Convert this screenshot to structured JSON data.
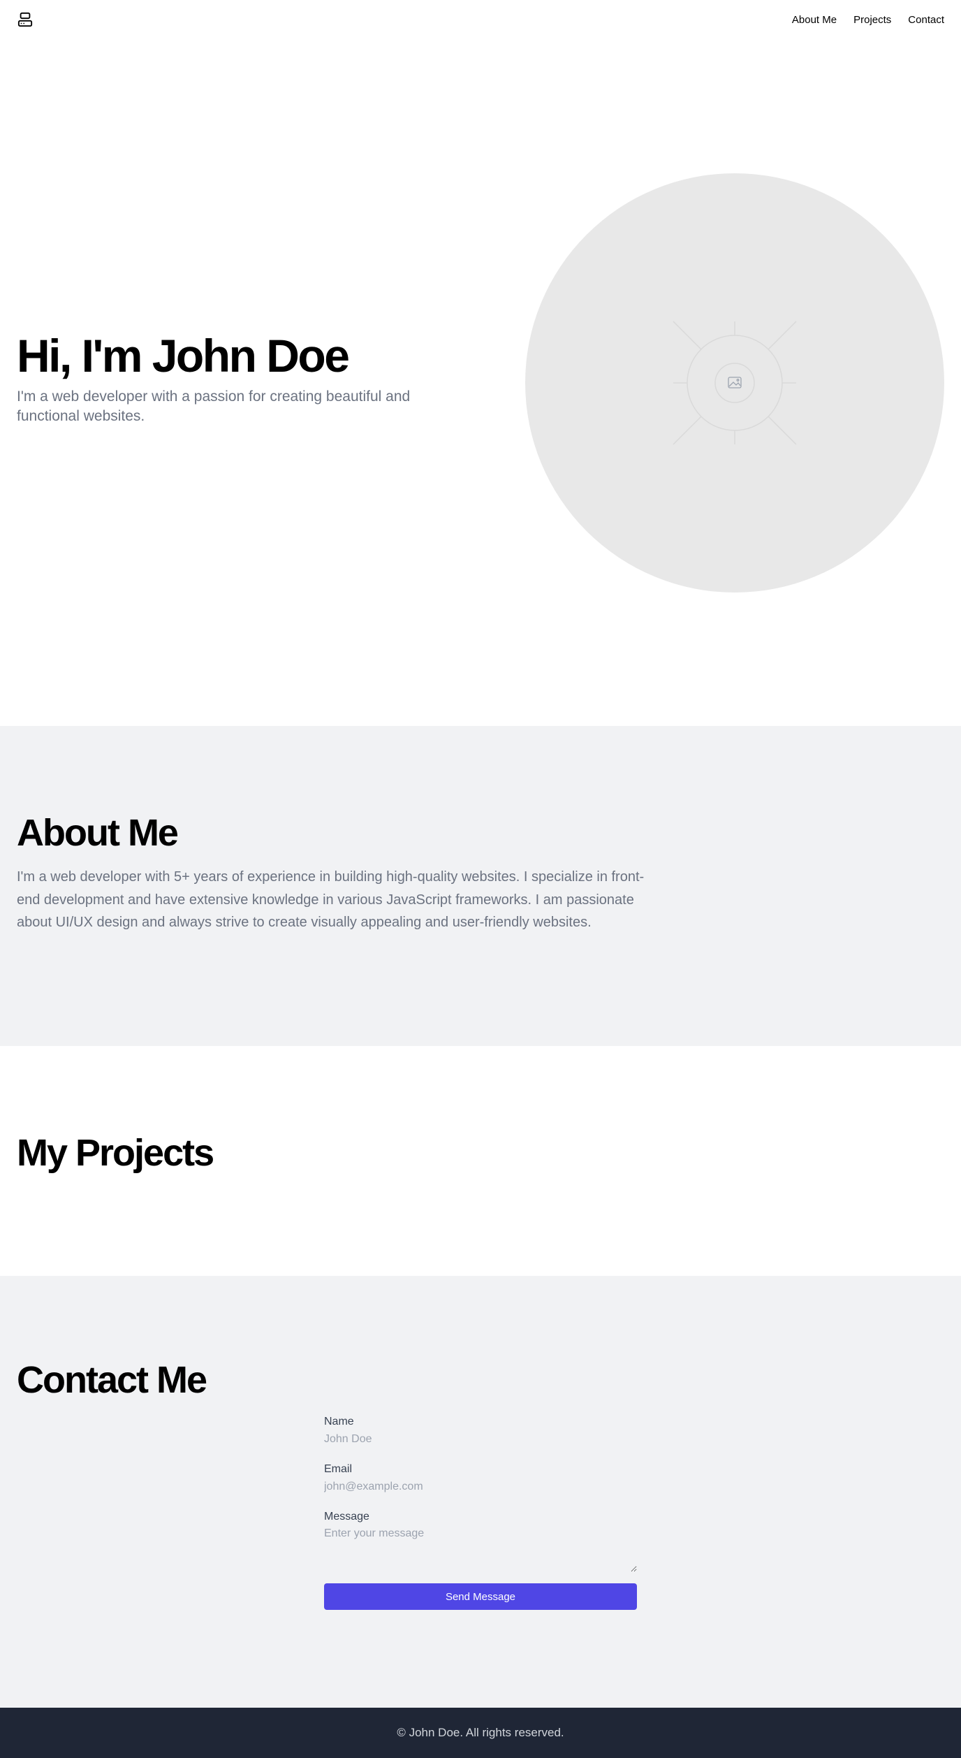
{
  "header": {
    "logo_icon": "server-stack-icon",
    "nav": [
      {
        "label": "About Me"
      },
      {
        "label": "Projects"
      },
      {
        "label": "Contact"
      }
    ]
  },
  "hero": {
    "title": "Hi, I'm John Doe",
    "subtitle": "I'm a web developer with a passion for creating beautiful and functional websites.",
    "image_icon": "image-placeholder-icon"
  },
  "about": {
    "title": "About Me",
    "text": "I'm a web developer with 5+ years of experience in building high-quality websites. I specialize in front-end development and have extensive knowledge in various JavaScript frameworks. I am passionate about UI/UX design and always strive to create visually appealing and user-friendly websites."
  },
  "projects": {
    "title": "My Projects"
  },
  "contact": {
    "title": "Contact Me",
    "name_label": "Name",
    "name_placeholder": "John Doe",
    "email_label": "Email",
    "email_placeholder": "john@example.com",
    "message_label": "Message",
    "message_placeholder": "Enter your message",
    "submit_label": "Send Message"
  },
  "footer": {
    "text": "© John Doe. All rights reserved."
  },
  "colors": {
    "accent": "#4f46e5",
    "section_alt_bg": "#f1f2f4",
    "footer_bg": "#1f2636",
    "muted_text": "#6b7280"
  }
}
